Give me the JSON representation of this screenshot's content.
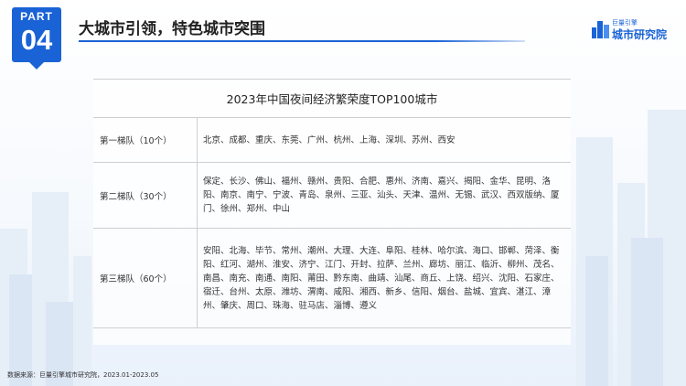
{
  "badge": {
    "part": "PART",
    "number": "04"
  },
  "header": {
    "title": "大城市引领，特色城市突围"
  },
  "brand": {
    "small": "巨量引擎",
    "main": "城市研究院",
    "icon": "city-buildings-icon"
  },
  "table": {
    "title": "2023年中国夜间经济繁荣度TOP100城市",
    "rows": [
      {
        "tier": "第一梯队（10个）",
        "cities": "北京、成都、重庆、东莞、广州、杭州、上海、深圳、苏州、西安"
      },
      {
        "tier": "第二梯队（30个）",
        "cities": "保定、长沙、佛山、福州、赣州、贵阳、合肥、惠州、济南、嘉兴、揭阳、金华、昆明、洛阳、南京、南宁、宁波、青岛、泉州、三亚、汕头、天津、温州、无锡、武汉、西双版纳、厦门、徐州、郑州、中山"
      },
      {
        "tier": "第三梯队（60个）",
        "cities": "安阳、北海、毕节、常州、潮州、大理、大连、阜阳、桂林、哈尔滨、海口、邯郸、菏泽、衡阳、红河、湖州、淮安、济宁、江门、开封、拉萨、兰州、廊坊、丽江、临沂、柳州、茂名、南昌、南充、南通、南阳、莆田、黔东南、曲靖、汕尾、商丘、上饶、绍兴、沈阳、石家庄、宿迁、台州、太原、潍坊、渭南、咸阳、湘西、新乡、信阳、烟台、盐城、宜宾、湛江、漳州、肇庆、周口、珠海、驻马店、淄博、遵义"
      }
    ]
  },
  "footer": {
    "source": "数据来源：巨量引擎城市研究院，2023.01-2023.05"
  },
  "colors": {
    "accent": "#1a63d6",
    "text": "#333333",
    "border": "#cfcfcf"
  }
}
